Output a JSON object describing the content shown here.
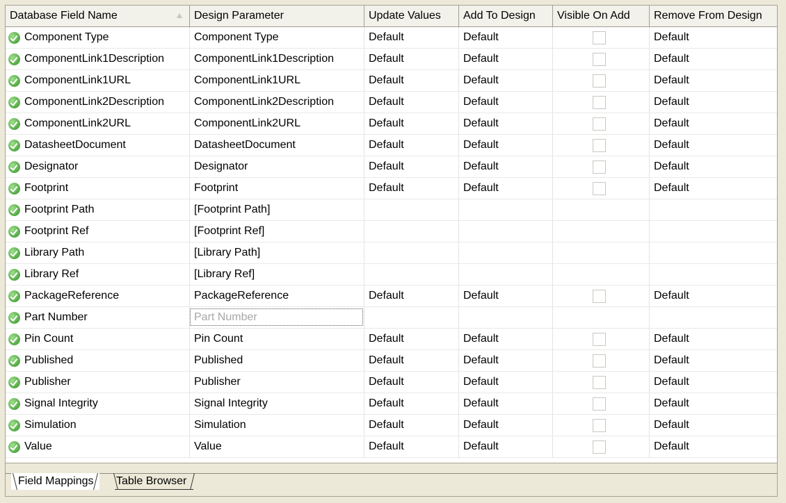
{
  "columns": [
    "Database Field Name",
    "Design Parameter",
    "Update Values",
    "Add To Design",
    "Visible On Add",
    "Remove From Design"
  ],
  "rows": [
    {
      "field": "Component Type",
      "param": "Component Type",
      "update": "Default",
      "add": "Default",
      "visible": false,
      "remove": "Default"
    },
    {
      "field": "ComponentLink1Description",
      "param": "ComponentLink1Description",
      "update": "Default",
      "add": "Default",
      "visible": false,
      "remove": "Default"
    },
    {
      "field": "ComponentLink1URL",
      "param": "ComponentLink1URL",
      "update": "Default",
      "add": "Default",
      "visible": false,
      "remove": "Default"
    },
    {
      "field": "ComponentLink2Description",
      "param": "ComponentLink2Description",
      "update": "Default",
      "add": "Default",
      "visible": false,
      "remove": "Default"
    },
    {
      "field": "ComponentLink2URL",
      "param": "ComponentLink2URL",
      "update": "Default",
      "add": "Default",
      "visible": false,
      "remove": "Default"
    },
    {
      "field": "DatasheetDocument",
      "param": "DatasheetDocument",
      "update": "Default",
      "add": "Default",
      "visible": false,
      "remove": "Default"
    },
    {
      "field": "Designator",
      "param": "Designator",
      "update": "Default",
      "add": "Default",
      "visible": false,
      "remove": "Default"
    },
    {
      "field": "Footprint",
      "param": "Footprint",
      "update": "Default",
      "add": "Default",
      "visible": false,
      "remove": "Default"
    },
    {
      "field": "Footprint Path",
      "param": "[Footprint Path]",
      "update": "",
      "add": "",
      "visible": null,
      "remove": ""
    },
    {
      "field": "Footprint Ref",
      "param": "[Footprint Ref]",
      "update": "",
      "add": "",
      "visible": null,
      "remove": ""
    },
    {
      "field": "Library Path",
      "param": "[Library Path]",
      "update": "",
      "add": "",
      "visible": null,
      "remove": ""
    },
    {
      "field": "Library Ref",
      "param": "[Library Ref]",
      "update": "",
      "add": "",
      "visible": null,
      "remove": ""
    },
    {
      "field": "PackageReference",
      "param": "PackageReference",
      "update": "Default",
      "add": "Default",
      "visible": false,
      "remove": "Default"
    },
    {
      "field": "Part Number",
      "param": "Part Number",
      "update": "",
      "add": "",
      "visible": null,
      "remove": "",
      "param_placeholder": true,
      "focused": true
    },
    {
      "field": "Pin Count",
      "param": "Pin Count",
      "update": "Default",
      "add": "Default",
      "visible": false,
      "remove": "Default"
    },
    {
      "field": "Published",
      "param": "Published",
      "update": "Default",
      "add": "Default",
      "visible": false,
      "remove": "Default"
    },
    {
      "field": "Publisher",
      "param": "Publisher",
      "update": "Default",
      "add": "Default",
      "visible": false,
      "remove": "Default"
    },
    {
      "field": "Signal Integrity",
      "param": "Signal Integrity",
      "update": "Default",
      "add": "Default",
      "visible": false,
      "remove": "Default"
    },
    {
      "field": "Simulation",
      "param": "Simulation",
      "update": "Default",
      "add": "Default",
      "visible": false,
      "remove": "Default"
    },
    {
      "field": "Value",
      "param": "Value",
      "update": "Default",
      "add": "Default",
      "visible": false,
      "remove": "Default"
    }
  ],
  "tabs": [
    {
      "label": "Field Mappings",
      "active": true
    },
    {
      "label": "Table Browser",
      "active": false
    }
  ],
  "row_icon": "green-check-icon",
  "sort_icon": "sort-ascending-icon"
}
